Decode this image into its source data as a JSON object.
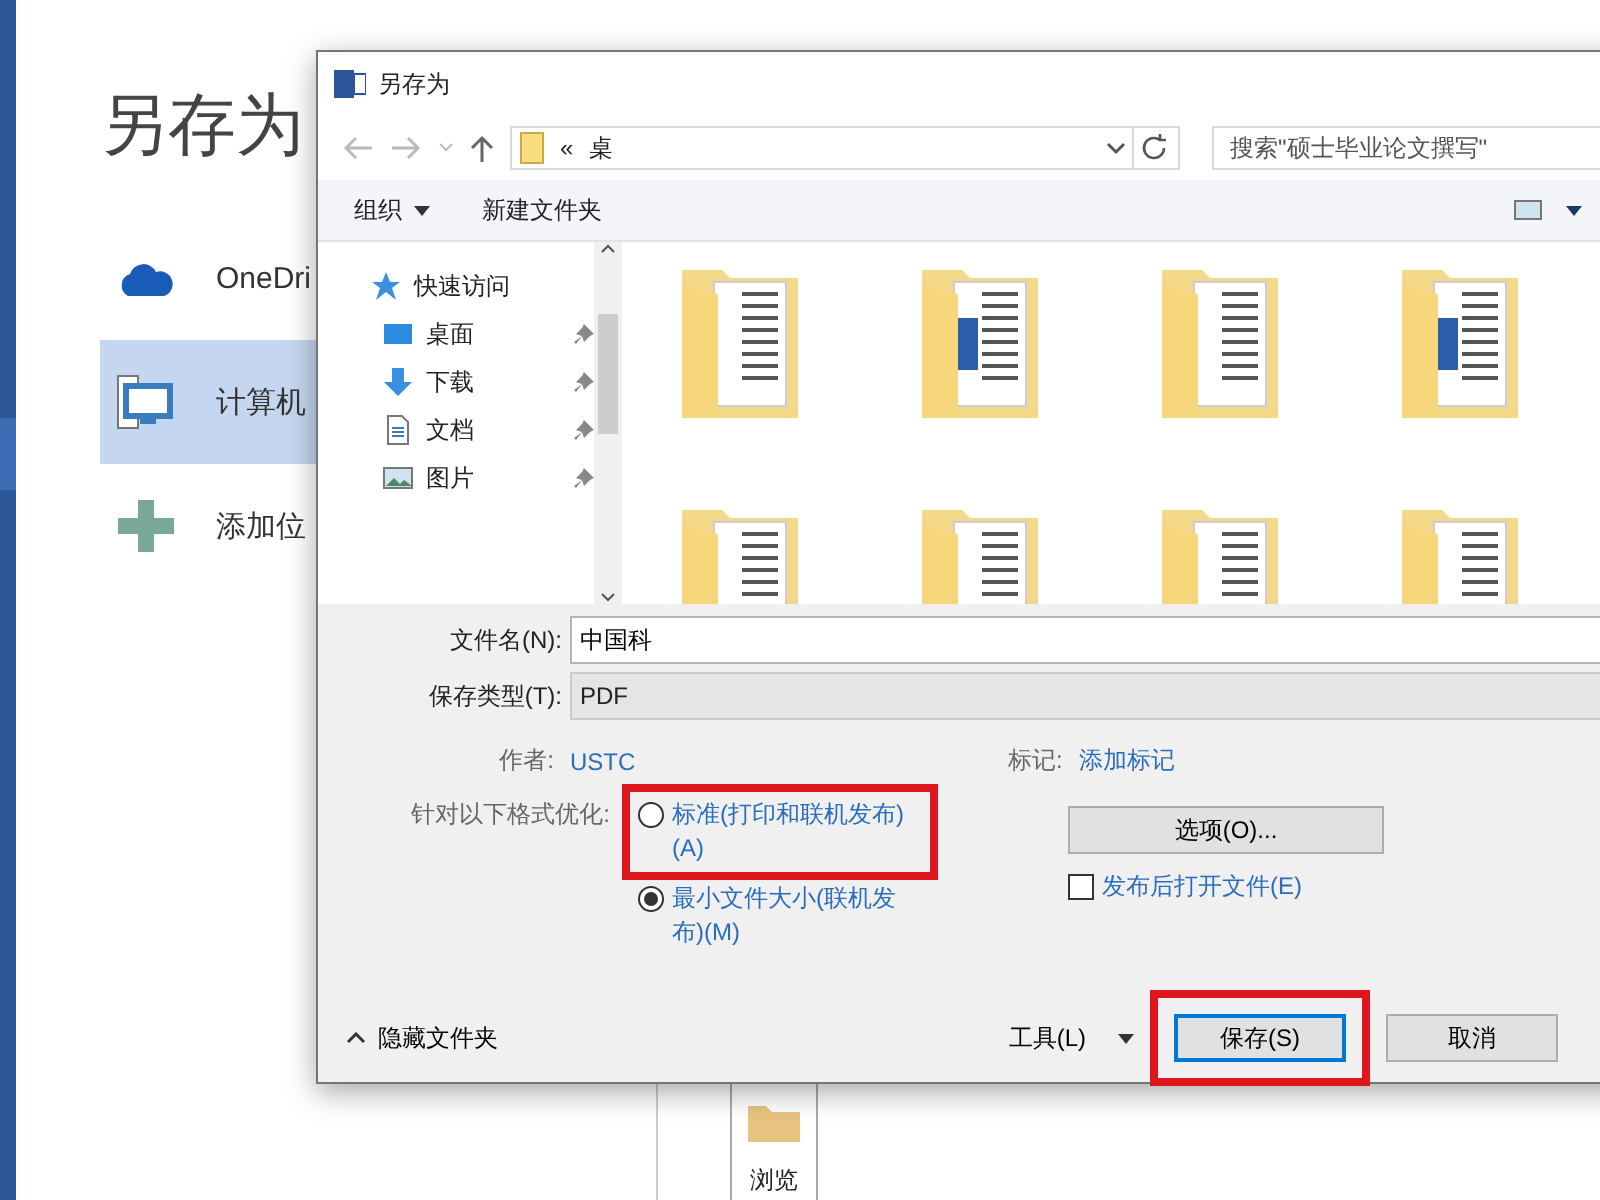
{
  "backstage": {
    "title": "另存为",
    "places": [
      {
        "label": "OneDri",
        "kind": "cloud",
        "selected": false
      },
      {
        "label": "计算机",
        "kind": "computer",
        "selected": true
      },
      {
        "label": "添加位",
        "kind": "add",
        "selected": false
      }
    ],
    "browse": {
      "label": "浏览"
    }
  },
  "dialog": {
    "title": "另存为",
    "address": {
      "separator": "«",
      "path": "桌"
    },
    "search": {
      "placeholder": "搜索\"硕士毕业论文撰写\""
    },
    "toolbar": {
      "organize": "组织",
      "new_folder": "新建文件夹"
    },
    "nav_items": [
      {
        "label": "快速访问",
        "kind": "star",
        "pinned": false
      },
      {
        "label": "桌面",
        "kind": "desktop",
        "pinned": true
      },
      {
        "label": "下载",
        "kind": "download",
        "pinned": true
      },
      {
        "label": "文档",
        "kind": "document",
        "pinned": true
      },
      {
        "label": "图片",
        "kind": "pictures",
        "pinned": true
      }
    ],
    "files": [
      {
        "kind": "pages"
      },
      {
        "kind": "word"
      },
      {
        "kind": "pages"
      },
      {
        "kind": "word"
      },
      {
        "kind": "pages"
      },
      {
        "kind": "pages"
      },
      {
        "kind": "pages"
      },
      {
        "kind": "pages"
      }
    ],
    "file_name": {
      "label": "文件名(N):",
      "value": "中国科"
    },
    "save_type": {
      "label": "保存类型(T):",
      "value": "PDF"
    },
    "author": {
      "label": "作者:",
      "value": "USTC"
    },
    "tags": {
      "label": "标记:",
      "value": "添加标记"
    },
    "optimize": {
      "label": "针对以下格式优化:",
      "options": [
        {
          "label": "标准(打印和联机发布)(A)",
          "selected": false,
          "highlighted": true
        },
        {
          "label": "最小文件大小(联机发布)(M)",
          "selected": true,
          "highlighted": false
        }
      ]
    },
    "options_button": "选项(O)...",
    "open_after": {
      "label": "发布后打开文件(E)",
      "checked": false
    },
    "hide_folders": "隐藏文件夹",
    "tools": "工具(L)",
    "save": {
      "label": "保存(S)",
      "highlighted": true
    },
    "cancel": "取消"
  }
}
